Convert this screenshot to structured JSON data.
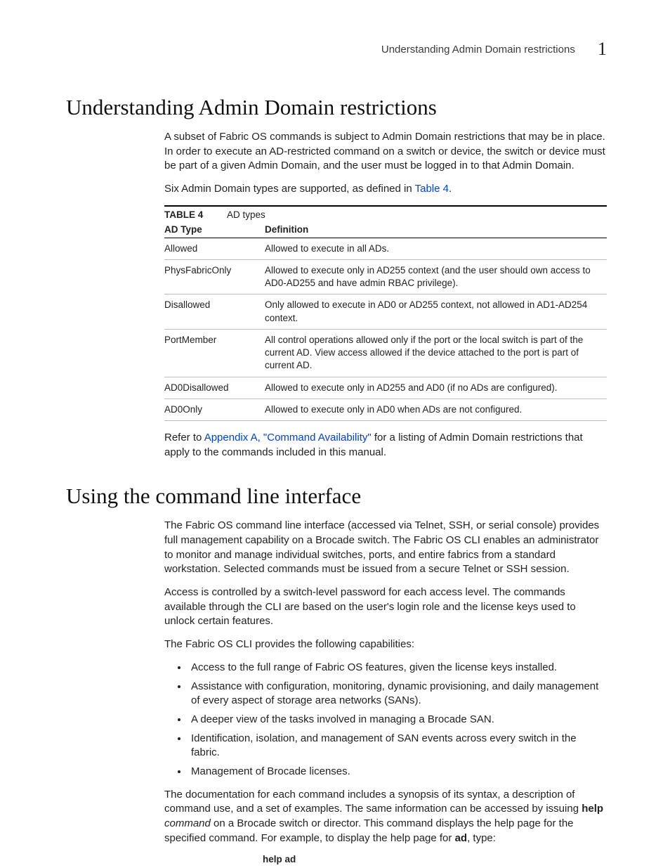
{
  "header": {
    "title": "Understanding Admin Domain restrictions",
    "chapter": "1"
  },
  "section1": {
    "heading": "Understanding Admin Domain restrictions",
    "para1": "A subset of Fabric OS commands is subject to Admin Domain restrictions that may be in place. In order to execute an AD-restricted command on a switch or device, the switch or device must be part of a given Admin Domain, and the user must be logged in to that Admin Domain.",
    "para2_a": "Six Admin Domain types are supported, as defined in ",
    "para2_link": "Table 4",
    "para2_b": ".",
    "table": {
      "label": "TABLE 4",
      "title": "AD types",
      "head": {
        "c1": "AD Type",
        "c2": "Definition"
      },
      "rows": [
        {
          "c1": "Allowed",
          "c2": "Allowed to execute in all ADs."
        },
        {
          "c1": "PhysFabricOnly",
          "c2": "Allowed to execute only in AD255 context (and the user should own access to AD0-AD255 and have admin RBAC privilege)."
        },
        {
          "c1": "Disallowed",
          "c2": "Only allowed to execute in AD0 or AD255 context, not allowed in AD1-AD254 context."
        },
        {
          "c1": "PortMember",
          "c2": "All control operations allowed only if the port or the local switch is part of the current AD. View access allowed if the device attached to the port is part of current AD."
        },
        {
          "c1": "AD0Disallowed",
          "c2": "Allowed to execute only in AD255 and AD0 (if no ADs are configured)."
        },
        {
          "c1": "AD0Only",
          "c2": "Allowed to execute only in AD0 when ADs are not configured."
        }
      ]
    },
    "para3_a": "Refer to ",
    "para3_link": "Appendix A, \"Command Availability\"",
    "para3_b": " for a listing of Admin Domain restrictions that apply to the commands included in this manual."
  },
  "section2": {
    "heading": "Using the command line interface",
    "para1": "The Fabric OS command line interface (accessed via Telnet, SSH, or serial console) provides full management capability on a Brocade switch. The Fabric OS CLI enables an administrator to monitor and manage individual switches, ports, and entire fabrics from a standard workstation. Selected commands must be issued from a secure Telnet or SSH session.",
    "para2": "Access is controlled by a switch-level password for each access level. The commands available through the CLI are based on the user's login role and the license keys used to unlock certain features.",
    "para3": "The Fabric OS CLI provides the following capabilities:",
    "bullets": [
      "Access to the full range of Fabric OS features, given the license keys installed.",
      "Assistance with configuration, monitoring, dynamic provisioning, and daily management of every aspect of storage area networks (SANs).",
      "A deeper view of the tasks involved in managing a Brocade SAN.",
      "Identification, isolation, and management of SAN events across every switch in the fabric.",
      "Management of Brocade licenses."
    ],
    "para4_a": "The documentation for each command includes a synopsis of its syntax, a description of command use, and a set of examples. The same information can be accessed by issuing ",
    "para4_help": "help",
    "para4_cmd": " command",
    "para4_b": " on a Brocade switch or director. This command displays the help page for the specified command. For example, to display the help page for ",
    "para4_ad": "ad",
    "para4_c": ", type:",
    "code": "help ad"
  }
}
